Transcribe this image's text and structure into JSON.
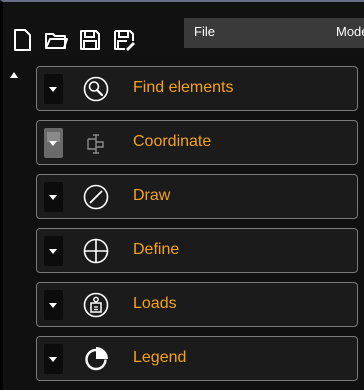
{
  "menu": {
    "file_label": "File",
    "next_label": "Mode"
  },
  "toolbar": {
    "buttons": [
      {
        "icon": "new-file-icon"
      },
      {
        "icon": "open-folder-icon"
      },
      {
        "icon": "save-icon"
      },
      {
        "icon": "save-as-icon"
      }
    ]
  },
  "panels": [
    {
      "label": "Find elements",
      "icon": "search-icon",
      "enabled": true
    },
    {
      "label": "Coordinate",
      "icon": "coordinate-icon",
      "enabled": false
    },
    {
      "label": "Draw",
      "icon": "draw-icon",
      "enabled": true
    },
    {
      "label": "Define",
      "icon": "define-icon",
      "enabled": true
    },
    {
      "label": "Loads",
      "icon": "loads-icon",
      "enabled": true
    },
    {
      "label": "Legend",
      "icon": "legend-icon",
      "enabled": true
    }
  ],
  "colors": {
    "accent_text": "#f4a21b",
    "panel_border": "#7a7a7a",
    "background": "#101010"
  }
}
